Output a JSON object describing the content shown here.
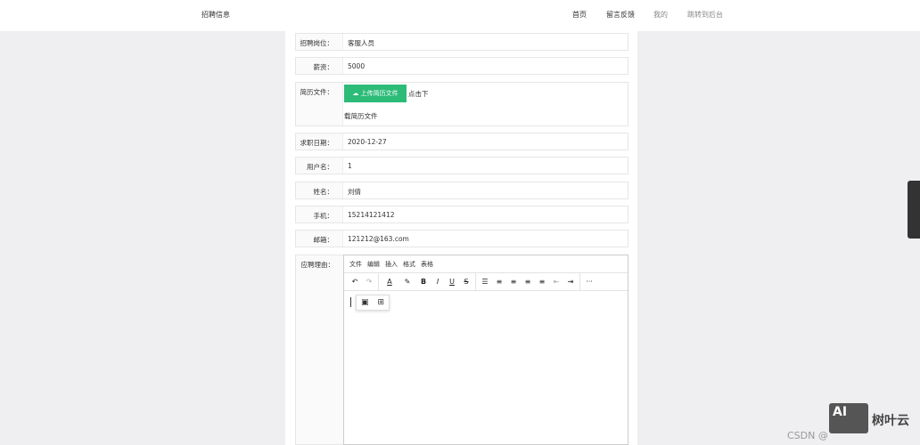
{
  "header": {
    "brand": "招聘信息",
    "nav": [
      "首页",
      "留言反馈",
      "我的",
      "跳转到后台"
    ]
  },
  "form": {
    "rows": [
      {
        "label": "招聘岗位：",
        "value": "客服人员"
      },
      {
        "label": "薪资：",
        "value": "5000"
      },
      {
        "label": "求职日期：",
        "value": "2020-12-27"
      },
      {
        "label": "用户名：",
        "value": "1"
      },
      {
        "label": "姓名：",
        "value": "刘倩"
      },
      {
        "label": "手机：",
        "value": "15214121412"
      },
      {
        "label": "邮箱：",
        "value": "121212@163.com"
      }
    ],
    "resume": {
      "label": "简历文件：",
      "upload_button": "上传简历文件",
      "hint": "点击下",
      "download": "载简历文件"
    },
    "reason": {
      "label": "应聘理由："
    }
  },
  "editor": {
    "menu": [
      "文件",
      "编辑",
      "插入",
      "格式",
      "表格"
    ],
    "toolbar": [
      "↶",
      "↷",
      "A",
      "✎",
      "B",
      "I",
      "U",
      "S",
      "☰",
      "≡",
      "≡",
      "≡",
      "≡",
      "⇤",
      "⇥",
      "···"
    ],
    "popup": [
      "▣",
      "⊞"
    ]
  },
  "watermark": {
    "text": "CSDN @",
    "logo": "AI",
    "brand": "树叶云"
  }
}
